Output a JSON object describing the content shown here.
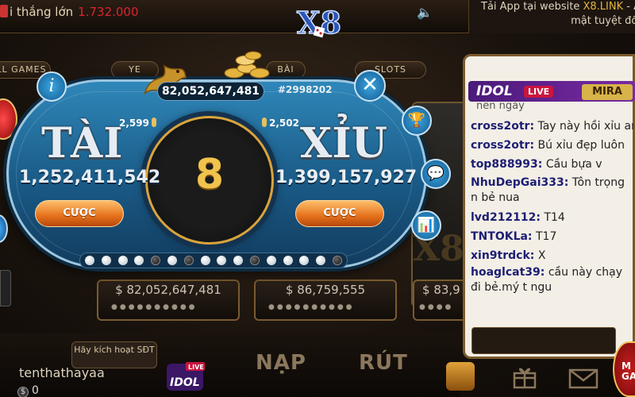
{
  "ticker": {
    "prefix": "i thắng lớn",
    "amount": "1.732.000"
  },
  "logo": {
    "text": "X8"
  },
  "notice": {
    "line1_pre": "Tải App tại website ",
    "line1_link": "X8.LINK",
    "line1_post": " - A",
    "line2": "mật tuyệt đối"
  },
  "tabs": [
    {
      "label": "LL GAMES"
    },
    {
      "label": "YE"
    },
    {
      "label": "BÀI"
    },
    {
      "label": "SLOTS"
    }
  ],
  "cards": [
    {
      "value": "82,052,647,481"
    },
    {
      "value": "86,759,555"
    },
    {
      "value": "83,9"
    }
  ],
  "game": {
    "jackpot": "82,052,647,481",
    "session": "#2998202",
    "timer": "8",
    "tai": {
      "title": "TÀI",
      "players": "2,599",
      "pool": "1,252,411,542",
      "bet_label": "CƯỢC"
    },
    "xiu": {
      "title": "XỈU",
      "players": "2,502",
      "pool": "1,399,157,927",
      "bet_label": "CƯỢC"
    },
    "history": [
      "w",
      "w",
      "w",
      "w",
      "b",
      "w",
      "b",
      "w",
      "w",
      "w",
      "b",
      "w",
      "w",
      "w",
      "w",
      "b"
    ]
  },
  "bottom": {
    "activate_label": "Hãy kích hoạt SĐT",
    "username": "tenthathayaa",
    "balance": "0",
    "deposit_label": "NẠP",
    "withdraw_label": "RÚT"
  },
  "chat": {
    "channel": "IDOL",
    "live_badge": "LIVE",
    "host": "MIRA",
    "pinned": "nên ngày",
    "messages": [
      {
        "user": "cross2otr:",
        "text": " Tay này hồi xỉu an"
      },
      {
        "user": "cross2otr:",
        "text": " Bú xỉu đẹp luôn"
      },
      {
        "user": "top888993:",
        "text": " Cầu bựa v"
      },
      {
        "user": "NhuDepGai333:",
        "text": " Tôn trọng n bẻ nua"
      },
      {
        "user": "lvd212112:",
        "text": " T14"
      },
      {
        "user": "TNTOKLa:",
        "text": " T17"
      },
      {
        "user": "xin9trdck:",
        "text": "  X"
      },
      {
        "user": "hoaglcat39:",
        "text": " cầu này chạy đi bẻ.mý t ngu"
      }
    ]
  },
  "colors": {
    "accent_gold": "#e4b43d",
    "modal_blue": "#1a5a86",
    "bet_orange": "#e5711c",
    "alert_red": "#d8262e"
  }
}
